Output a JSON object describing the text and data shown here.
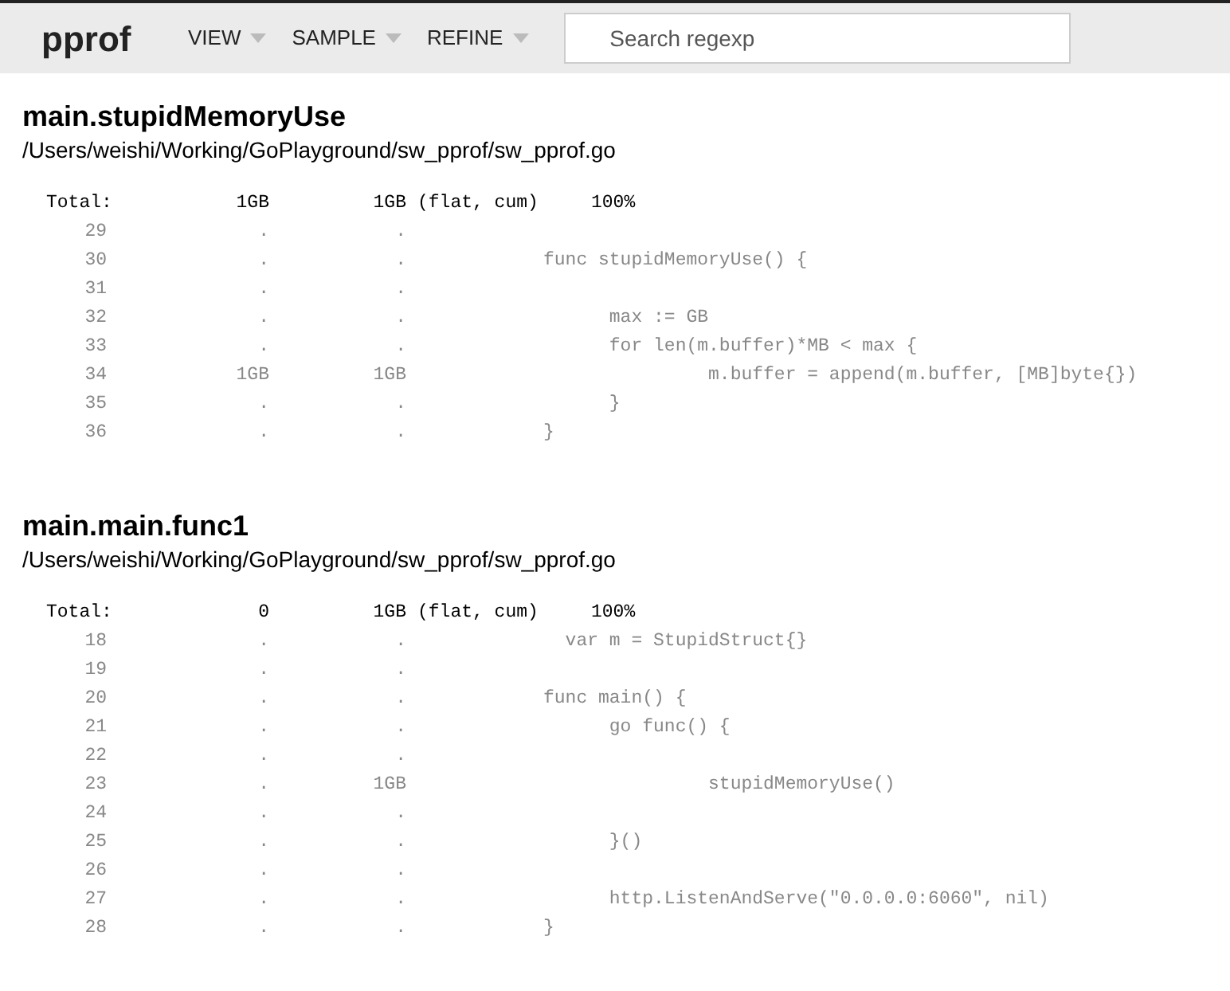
{
  "app_title": "pprof",
  "menus": [
    {
      "label": "VIEW"
    },
    {
      "label": "SAMPLE"
    },
    {
      "label": "REFINE"
    }
  ],
  "search": {
    "placeholder": "Search regexp"
  },
  "sections": [
    {
      "function": "main.stupidMemoryUse",
      "file": "/Users/weishi/Working/GoPlayground/sw_pprof/sw_pprof.go",
      "total": {
        "label": "Total:",
        "flat": "1GB",
        "cum": "1GB",
        "note": "(flat, cum)",
        "percent": "100%"
      },
      "lines": [
        {
          "line": "29",
          "flat": ".",
          "cum": "."
        },
        {
          "line": "30",
          "flat": ".",
          "cum": ".",
          "code": "func stupidMemoryUse() {"
        },
        {
          "line": "31",
          "flat": ".",
          "cum": "."
        },
        {
          "line": "32",
          "flat": ".",
          "cum": ".",
          "code": "      max := GB"
        },
        {
          "line": "33",
          "flat": ".",
          "cum": ".",
          "code": "      for len(m.buffer)*MB < max {"
        },
        {
          "line": "34",
          "flat": "1GB",
          "cum": "1GB",
          "code": "               m.buffer = append(m.buffer, [MB]byte{})"
        },
        {
          "line": "35",
          "flat": ".",
          "cum": ".",
          "code": "      }"
        },
        {
          "line": "36",
          "flat": ".",
          "cum": ".",
          "code": "}"
        }
      ]
    },
    {
      "function": "main.main.func1",
      "file": "/Users/weishi/Working/GoPlayground/sw_pprof/sw_pprof.go",
      "total": {
        "label": "Total:",
        "flat": "0",
        "cum": "1GB",
        "note": "(flat, cum)",
        "percent": "100%"
      },
      "lines": [
        {
          "line": "18",
          "flat": ".",
          "cum": ".",
          "code": "  var m = StupidStruct{}"
        },
        {
          "line": "19",
          "flat": ".",
          "cum": "."
        },
        {
          "line": "20",
          "flat": ".",
          "cum": ".",
          "code": "func main() {"
        },
        {
          "line": "21",
          "flat": ".",
          "cum": ".",
          "code": "      go func() {"
        },
        {
          "line": "22",
          "flat": ".",
          "cum": "."
        },
        {
          "line": "23",
          "flat": ".",
          "cum": "1GB",
          "code": "               stupidMemoryUse()"
        },
        {
          "line": "24",
          "flat": ".",
          "cum": "."
        },
        {
          "line": "25",
          "flat": ".",
          "cum": ".",
          "code": "      }()"
        },
        {
          "line": "26",
          "flat": ".",
          "cum": "."
        },
        {
          "line": "27",
          "flat": ".",
          "cum": ".",
          "code": "      http.ListenAndServe(\"0.0.0.0:6060\", nil)"
        },
        {
          "line": "28",
          "flat": ".",
          "cum": ".",
          "code": "}"
        }
      ]
    }
  ]
}
